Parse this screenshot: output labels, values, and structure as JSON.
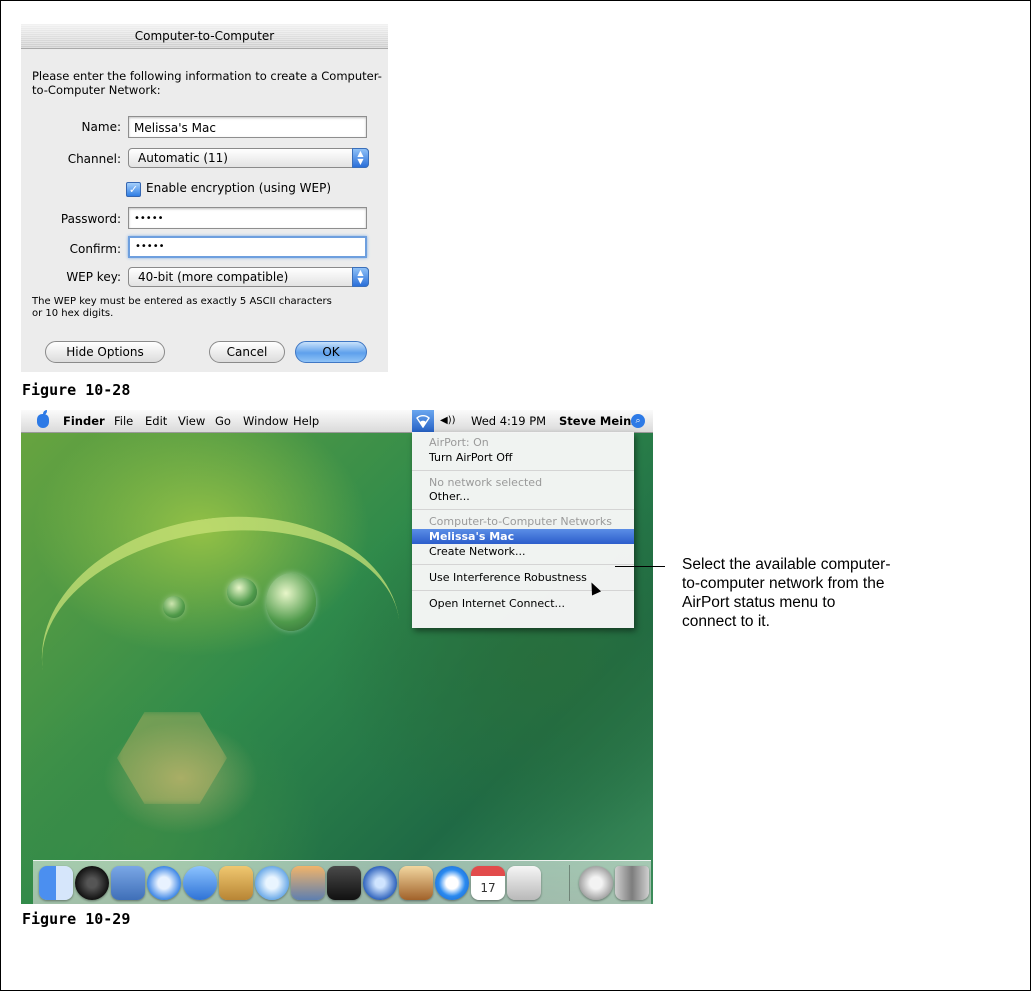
{
  "dialog": {
    "title": "Computer-to-Computer",
    "intro": "Please enter the following information to create a Computer-to-Computer Network:",
    "name_label": "Name:",
    "name_value": "Melissa's Mac",
    "channel_label": "Channel:",
    "channel_value": "Automatic (11)",
    "encryption_label": "Enable encryption (using WEP)",
    "encryption_checked": true,
    "password_label": "Password:",
    "password_value": "•••••",
    "confirm_label": "Confirm:",
    "confirm_value": "•••••",
    "wep_label": "WEP key:",
    "wep_value": "40-bit (more compatible)",
    "note": "The WEP key must be entered as exactly 5 ASCII characters or 10 hex digits.",
    "hide_options": "Hide Options",
    "cancel": "Cancel",
    "ok": "OK"
  },
  "figure1_caption": "Figure 10-28",
  "menubar": {
    "items": [
      "Finder",
      "File",
      "Edit",
      "View",
      "Go",
      "Window",
      "Help"
    ],
    "volume_glyph": "◀))",
    "clock": "Wed 4:19 PM",
    "user": "Steve Meinz"
  },
  "airport_menu": {
    "status": "AirPort: On",
    "turn_off": "Turn AirPort Off",
    "no_network": "No network selected",
    "other": "Other...",
    "c2c_header": "Computer-to-Computer Networks",
    "selected_network": "Melissa's Mac",
    "create_network": "Create Network...",
    "interference": "Use Interference Robustness",
    "open_connect": "Open Internet Connect..."
  },
  "dock": {
    "icons": [
      "finder-icon",
      "dashboard-icon",
      "mail-icon",
      "safari-icon",
      "ichat-icon",
      "address-book-icon",
      "itunes-icon",
      "iphoto-icon",
      "imovie-icon",
      "idvd-icon",
      "garageband-icon",
      "quicktime-icon",
      "ical-icon",
      "preview-icon",
      "system-preferences-icon",
      "mail-at-icon",
      "trash-icon"
    ],
    "ical_day": "17"
  },
  "figure2_caption": "Figure 10-29",
  "callout": "Select the available computer-to-computer network from the AirPort status menu to connect to it."
}
